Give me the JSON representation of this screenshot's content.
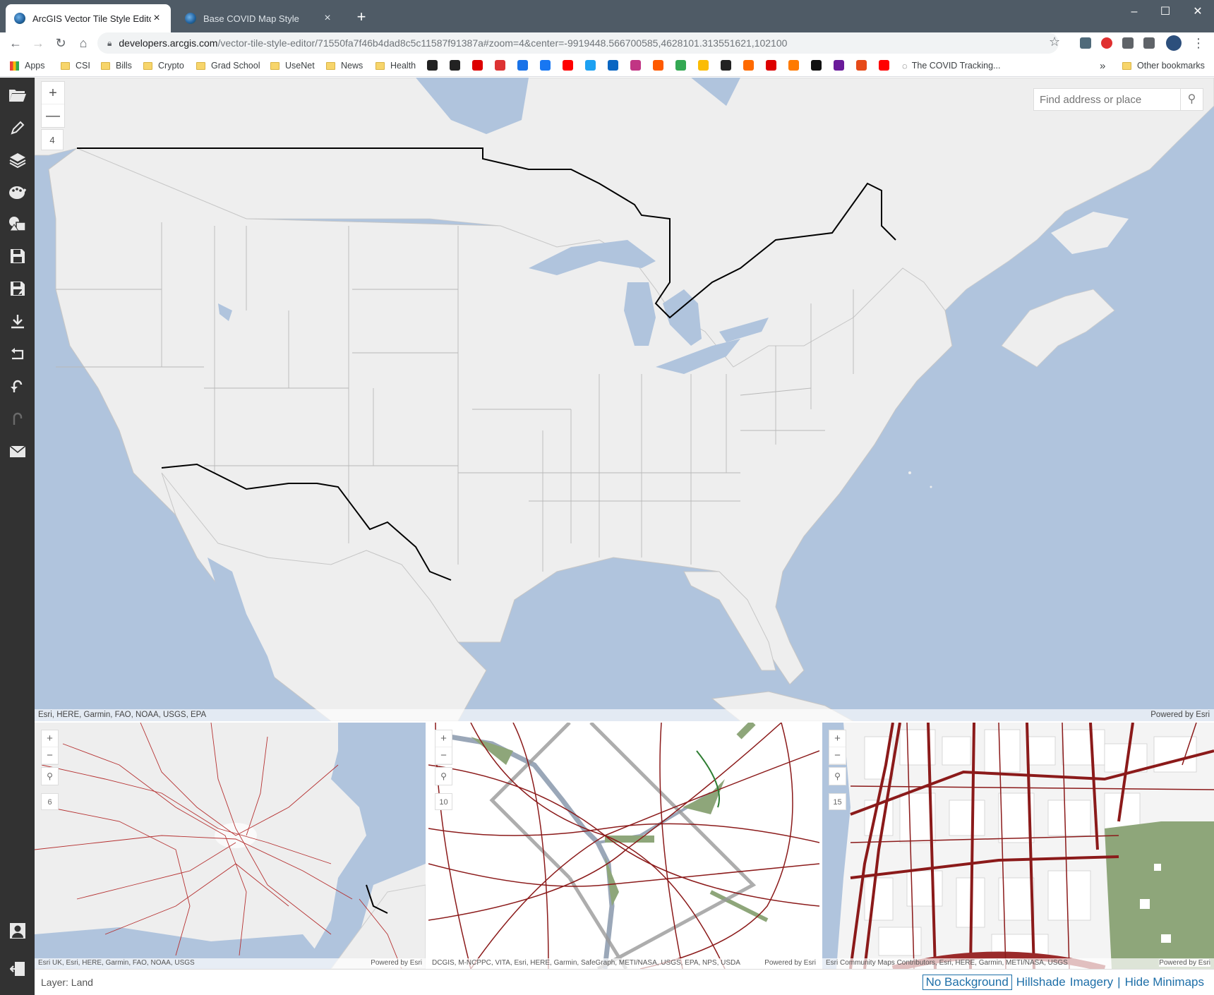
{
  "browser": {
    "tabs": [
      {
        "title": "ArcGIS Vector Tile Style Editor",
        "active": true
      },
      {
        "title": "Base COVID Map Style",
        "active": false
      }
    ],
    "url_host": "developers.arcgis.com",
    "url_rest": "/vector-tile-style-editor/71550fa7f46b4dad8c5c11587f91387a#zoom=4&center=-9919448.566700585,4628101.313551621,102100",
    "bookmarks": {
      "apps": "Apps",
      "folders": [
        "CSI",
        "Bills",
        "Crypto",
        "Grad School",
        "UseNet",
        "News",
        "Health"
      ],
      "covid": "The COVID Tracking...",
      "other": "Other bookmarks",
      "more": "»"
    }
  },
  "sidebar": {
    "tools": [
      "open-folder-icon",
      "pencil-icon",
      "layers-icon",
      "palette-icon",
      "shapes-icon",
      "save-icon",
      "save-as-icon",
      "download-icon",
      "revert-icon",
      "undo-icon",
      "redo-icon",
      "mail-icon",
      "user-icon",
      "sign-out-icon"
    ]
  },
  "main_map": {
    "zoom_in": "+",
    "zoom_out": "—",
    "zoom_level": "4",
    "search_placeholder": "Find address or place",
    "attribution": "Esri, HERE, Garmin, FAO, NOAA, USGS, EPA",
    "powered_by": "Powered by Esri"
  },
  "minimaps": [
    {
      "zoom_level": "6",
      "attribution": "Esri UK, Esri, HERE, Garmin, FAO, NOAA, USGS",
      "powered_by": "Powered by Esri"
    },
    {
      "zoom_level": "10",
      "attribution": "DCGIS, M-NCPPC, VITA, Esri, HERE, Garmin, SafeGraph, METI/NASA, USGS, EPA, NPS, USDA",
      "powered_by": "Powered by Esri"
    },
    {
      "zoom_level": "15",
      "attribution": "Esri Community Maps Contributors, Esri, HERE, Garmin, METI/NASA, USGS",
      "powered_by": "Powered by Esri"
    }
  ],
  "statusbar": {
    "layer": "Layer: Land",
    "backgrounds": {
      "none": "No Background",
      "hillshade": "Hillshade",
      "imagery": "Imagery",
      "sep": "|",
      "hide": "Hide Minimaps"
    }
  },
  "colors": {
    "water": "#b0c4dd",
    "land": "#eeeeee",
    "road": "#8b1a1a",
    "park": "#8ea67a",
    "sidebar": "#323232",
    "link": "#1e6fa8"
  }
}
